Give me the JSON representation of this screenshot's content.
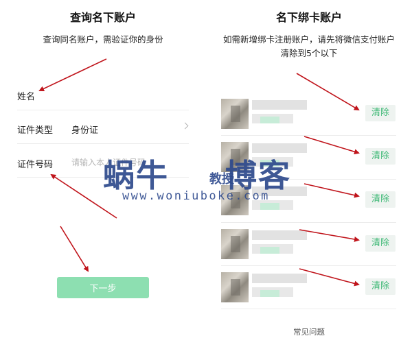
{
  "left_panel": {
    "title": "查询名下账户",
    "subtitle": "查询同名账户，需验证你的身份",
    "fields": [
      {
        "label": "姓名"
      },
      {
        "label": "证件类型",
        "value": "身份证"
      },
      {
        "label": "证件号码",
        "placeholder": "请输入本人证件号码"
      }
    ],
    "next_button": "下一步"
  },
  "right_panel": {
    "title": "名下绑卡账户",
    "subtitle": "如需新增绑卡注册账户，请先将微信支付账户清除到5个以下",
    "accounts": [
      {
        "action": "清除"
      },
      {
        "action": "清除"
      },
      {
        "action": "清除"
      },
      {
        "action": "清除"
      },
      {
        "action": "清除"
      }
    ],
    "faq_link": "常见问题"
  },
  "watermark": {
    "text_cn_1": "蜗牛",
    "text_cn_small": "教授",
    "text_cn_2": "博客",
    "url": "www.woniuboke.com"
  },
  "colors": {
    "accent_green": "#3fb976",
    "button_green_disabled": "#8ddfb1",
    "annotation_red": "#c0141b",
    "watermark_blue": "#2e4a8d"
  }
}
